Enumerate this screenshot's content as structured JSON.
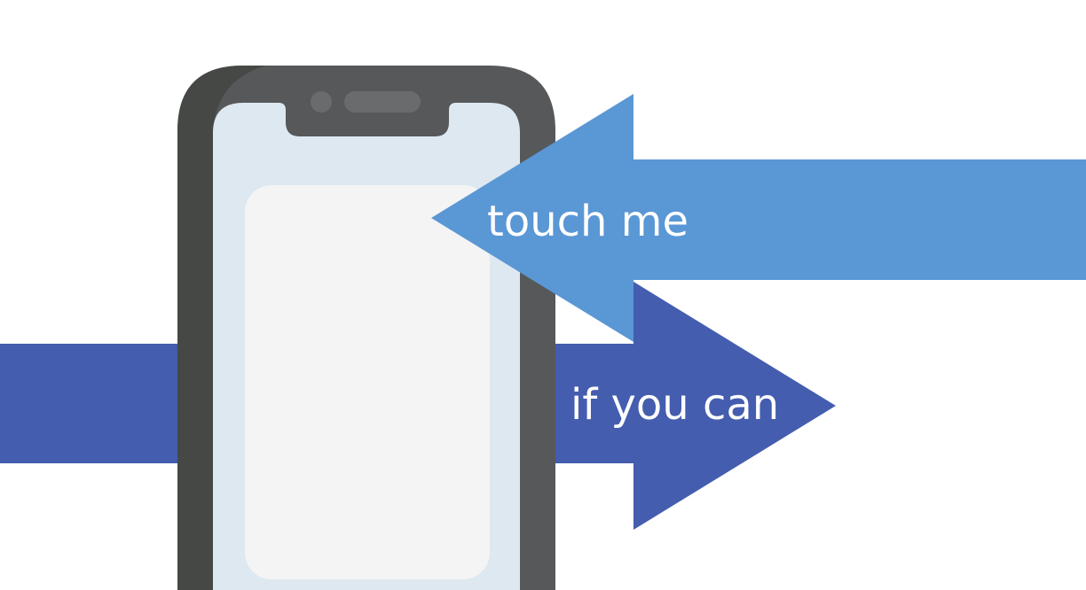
{
  "colors": {
    "background": "#ffffff",
    "phone_body": "#56585a",
    "phone_body_shadow": "#464846",
    "phone_notch_speaker": "#6a6b6c",
    "phone_screen_border": "#dde8f0",
    "phone_screen": "#f4f4f4",
    "arrow_touch": "#5a97d5",
    "arrow_ifyoucan": "#445daf",
    "arrow_text": "#ffffff"
  },
  "illustration": {
    "phone_icon": "smartphone-icon",
    "arrow_left_icon": "arrow-left-icon",
    "arrow_right_icon": "arrow-right-icon"
  },
  "labels": {
    "touch": "touch me",
    "if_you_can": "if you can"
  }
}
